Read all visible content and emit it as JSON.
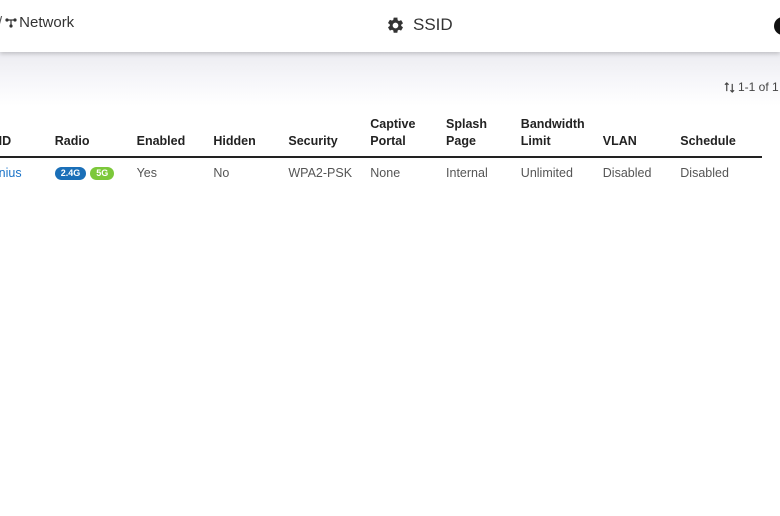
{
  "header": {
    "breadcrumb_sep": "/",
    "breadcrumb_network": "Network",
    "title": "SSID",
    "title_icon": "gear-icon"
  },
  "pager": {
    "text": "1-1 of 1",
    "icon": "sort-icon"
  },
  "table": {
    "headers": [
      {
        "line1": "SSID",
        "line2": ""
      },
      {
        "line1": "Radio",
        "line2": ""
      },
      {
        "line1": "Enabled",
        "line2": ""
      },
      {
        "line1": "Hidden",
        "line2": ""
      },
      {
        "line1": "Security",
        "line2": ""
      },
      {
        "line1": "Captive",
        "line2": "Portal"
      },
      {
        "line1": "Splash",
        "line2": "Page"
      },
      {
        "line1": "Bandwidth",
        "line2": "Limit"
      },
      {
        "line1": "VLAN",
        "line2": ""
      },
      {
        "line1": "Schedule",
        "line2": ""
      }
    ],
    "rows": [
      {
        "ssid": "Genius",
        "radio_badges": [
          "2.4G",
          "5G"
        ],
        "enabled": "Yes",
        "hidden": "No",
        "security": "WPA2-PSK",
        "captive_portal": "None",
        "splash_page": "Internal",
        "bandwidth_limit": "Unlimited",
        "vlan": "Disabled",
        "schedule": "Disabled"
      }
    ]
  },
  "colors": {
    "link": "#1a73c8",
    "badge_24": "#1a6fb8",
    "badge_5": "#7cc83a"
  }
}
